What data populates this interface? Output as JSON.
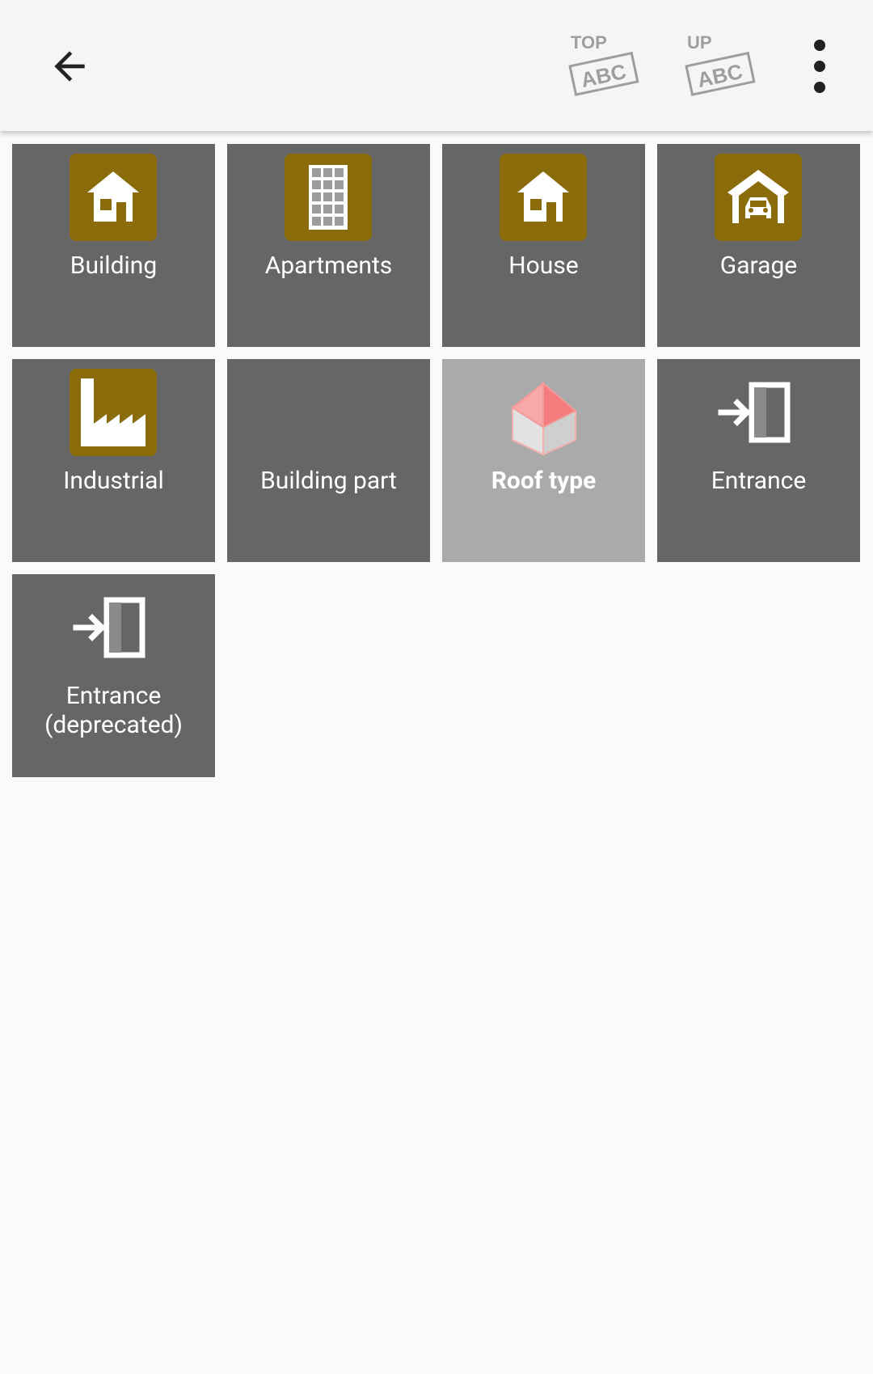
{
  "toolbar": {
    "back_icon": "arrow-left-icon",
    "top_label": "TOP",
    "up_label": "UP",
    "abc_label": "ABC",
    "more_icon": "more-vert-icon"
  },
  "tiles": [
    {
      "label": "Building",
      "icon": "building-icon"
    },
    {
      "label": "Apartments",
      "icon": "apartments-icon"
    },
    {
      "label": "House",
      "icon": "house-icon"
    },
    {
      "label": "Garage",
      "icon": "garage-icon"
    },
    {
      "label": "Industrial",
      "icon": "industrial-icon"
    },
    {
      "label": "Building part",
      "icon": ""
    },
    {
      "label": "Roof type",
      "icon": "roof-icon",
      "selected": true
    },
    {
      "label": "Entrance",
      "icon": "entrance-icon"
    },
    {
      "label": "Entrance (deprecated)",
      "icon": "entrance-icon"
    }
  ],
  "colors": {
    "tile_bg": "#666666",
    "tile_selected_bg": "#aaaaaa",
    "icon_brown": "#8b6c0b",
    "toolbar_bg": "#f5f5f5",
    "page_bg": "#fafafa"
  }
}
